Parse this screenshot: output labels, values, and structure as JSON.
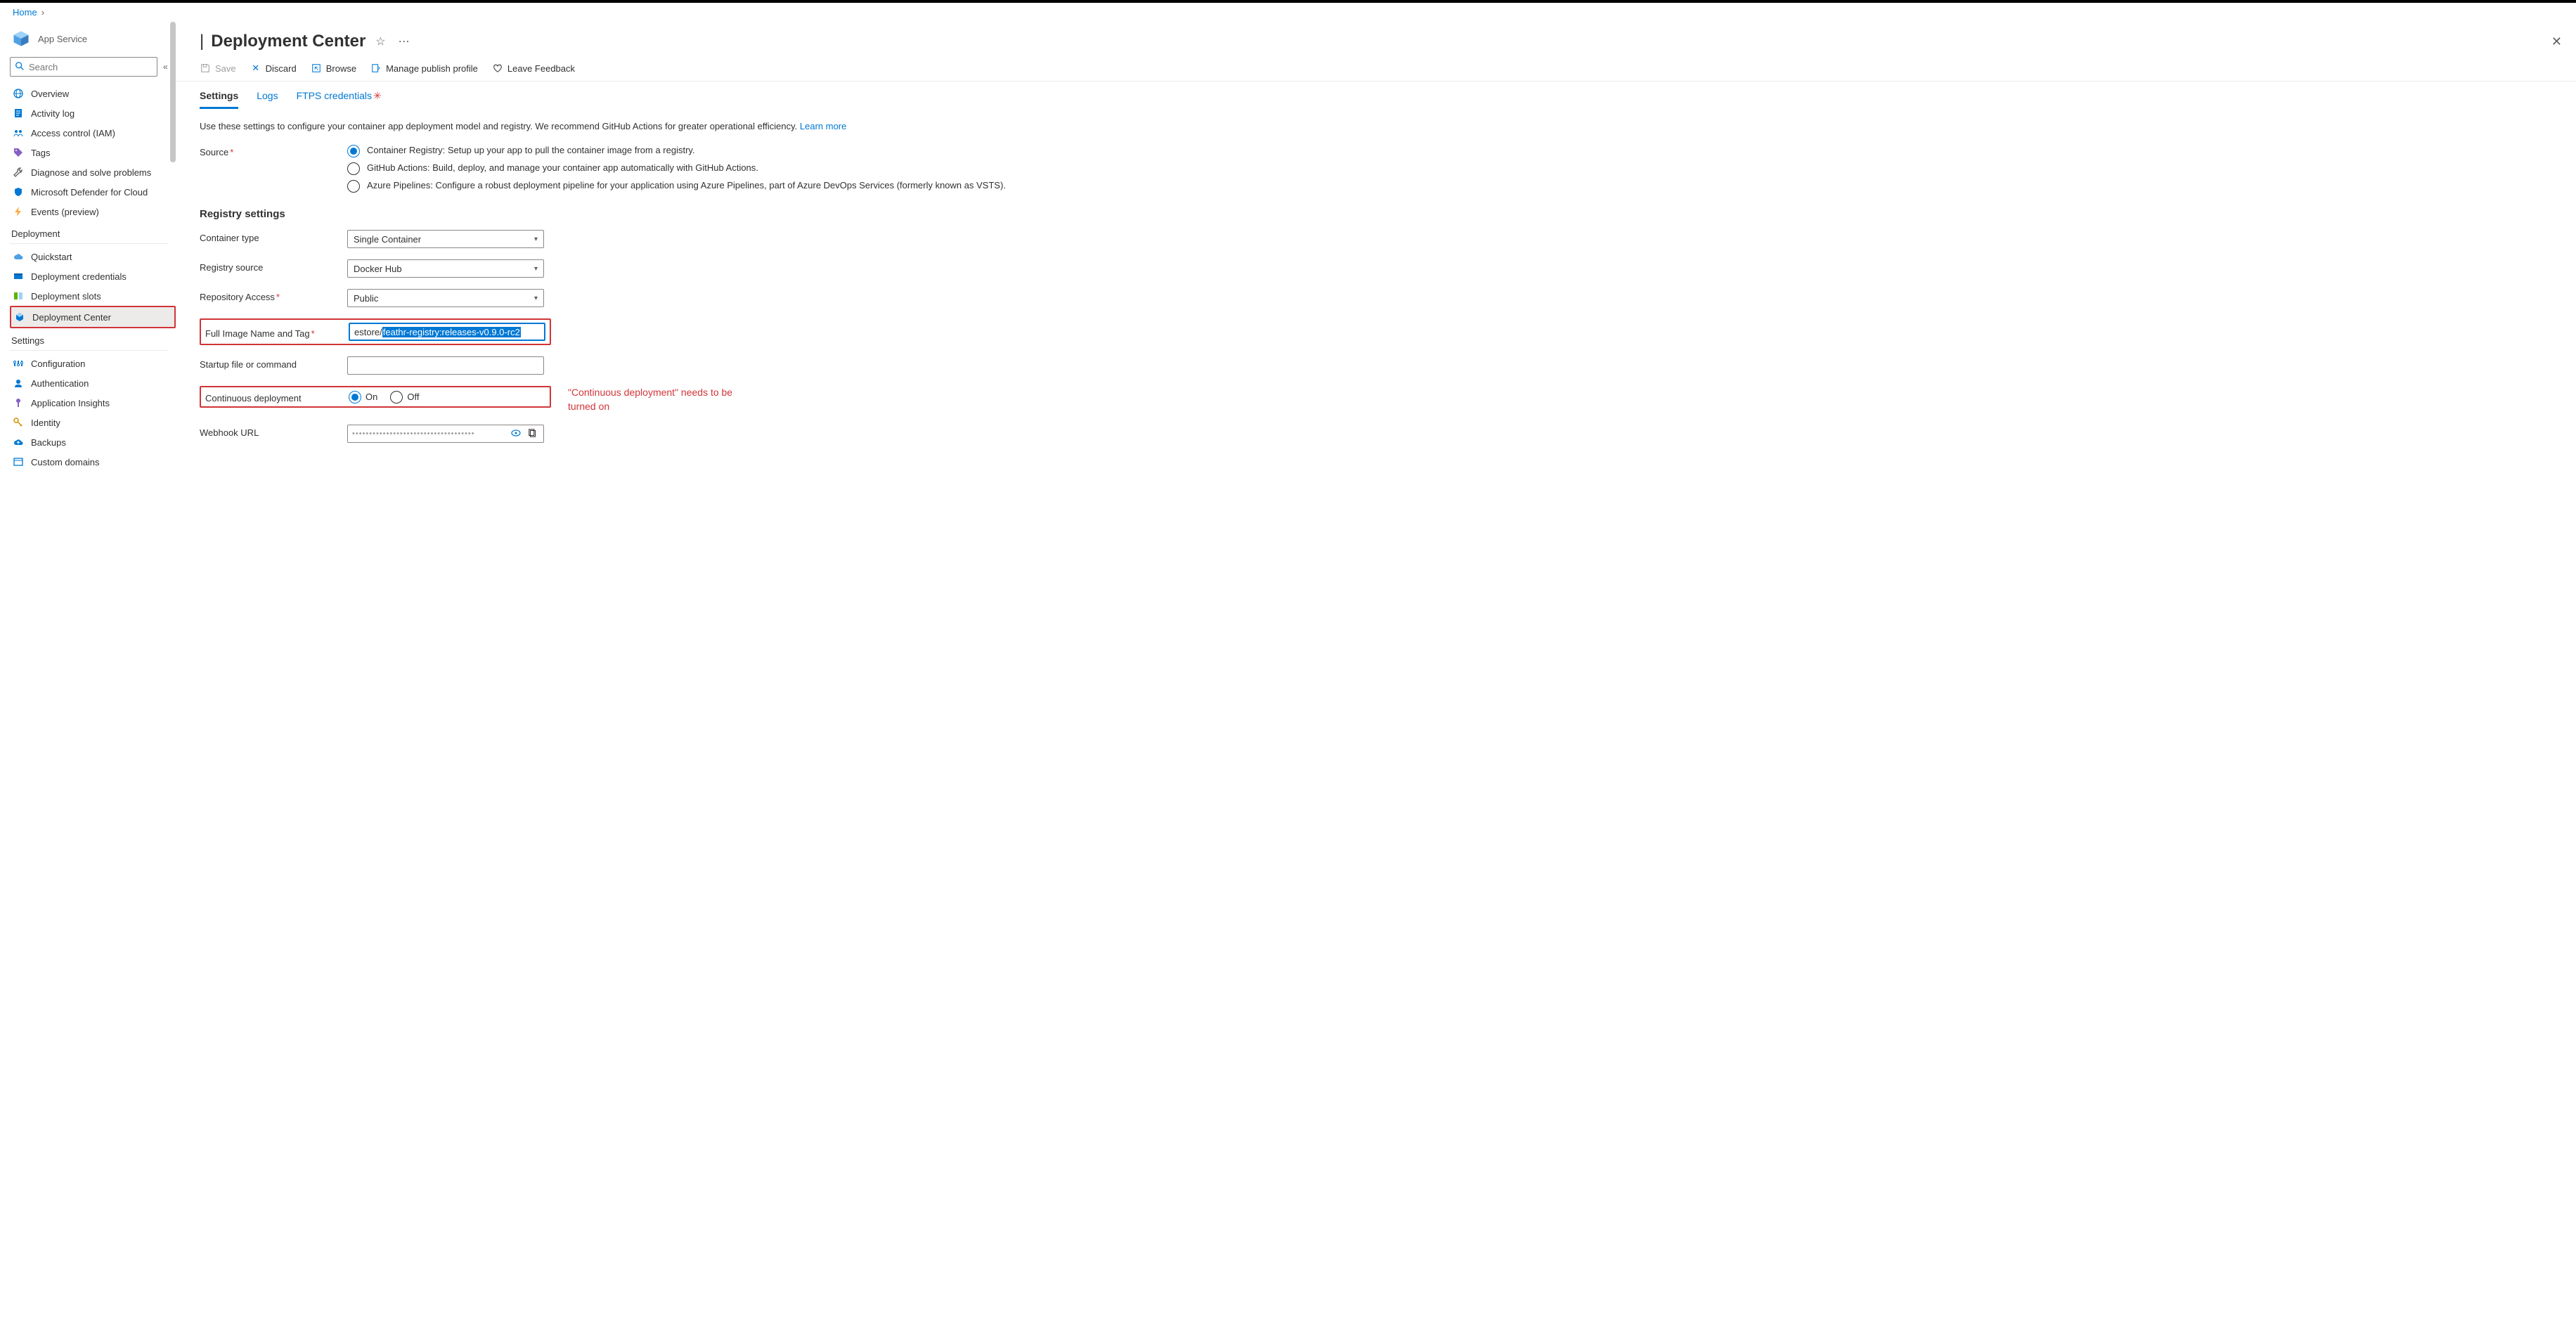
{
  "breadcrumb": {
    "home": "Home"
  },
  "resource": {
    "subtype": "App Service"
  },
  "search": {
    "placeholder": "Search"
  },
  "sidebar": {
    "items_top": [
      {
        "label": "Overview",
        "icon": "globe"
      },
      {
        "label": "Activity log",
        "icon": "log"
      },
      {
        "label": "Access control (IAM)",
        "icon": "people"
      },
      {
        "label": "Tags",
        "icon": "tag"
      },
      {
        "label": "Diagnose and solve problems",
        "icon": "wrench"
      },
      {
        "label": "Microsoft Defender for Cloud",
        "icon": "shield"
      },
      {
        "label": "Events (preview)",
        "icon": "bolt"
      }
    ],
    "group_deploy_title": "Deployment",
    "items_deploy": [
      {
        "label": "Quickstart",
        "icon": "cloud"
      },
      {
        "label": "Deployment credentials",
        "icon": "cred"
      },
      {
        "label": "Deployment slots",
        "icon": "slots"
      },
      {
        "label": "Deployment Center",
        "icon": "box",
        "selected": true
      }
    ],
    "group_settings_title": "Settings",
    "items_settings": [
      {
        "label": "Configuration",
        "icon": "sliders"
      },
      {
        "label": "Authentication",
        "icon": "auth"
      },
      {
        "label": "Application Insights",
        "icon": "insights"
      },
      {
        "label": "Identity",
        "icon": "key"
      },
      {
        "label": "Backups",
        "icon": "backup"
      },
      {
        "label": "Custom domains",
        "icon": "domains"
      }
    ]
  },
  "page": {
    "title": "Deployment Center"
  },
  "toolbar": {
    "save": "Save",
    "discard": "Discard",
    "browse": "Browse",
    "manage": "Manage publish profile",
    "feedback": "Leave Feedback"
  },
  "tabs": {
    "settings": "Settings",
    "logs": "Logs",
    "ftps": "FTPS credentials"
  },
  "desc": {
    "text": "Use these settings to configure your container app deployment model and registry. We recommend GitHub Actions for greater operational efficiency. ",
    "learn": "Learn more"
  },
  "form": {
    "source_label": "Source",
    "source_options": [
      "Container Registry: Setup up your app to pull the container image from a registry.",
      "GitHub Actions: Build, deploy, and manage your container app automatically with GitHub Actions.",
      "Azure Pipelines: Configure a robust deployment pipeline for your application using Azure Pipelines, part of Azure DevOps Services (formerly known as VSTS)."
    ],
    "registry_heading": "Registry settings",
    "container_type_label": "Container type",
    "container_type_value": "Single Container",
    "registry_source_label": "Registry source",
    "registry_source_value": "Docker Hub",
    "repo_access_label": "Repository Access",
    "repo_access_value": "Public",
    "full_image_label": "Full Image Name and Tag",
    "full_image_prefix": "estore/",
    "full_image_selected": "feathr-registry:releases-v0.9.0-rc2",
    "startup_label": "Startup file or command",
    "startup_value": "",
    "cd_label": "Continuous deployment",
    "cd_on": "On",
    "cd_off": "Off",
    "cd_note": "\"Continuous deployment\" needs to be turned on",
    "webhook_label": "Webhook URL"
  }
}
